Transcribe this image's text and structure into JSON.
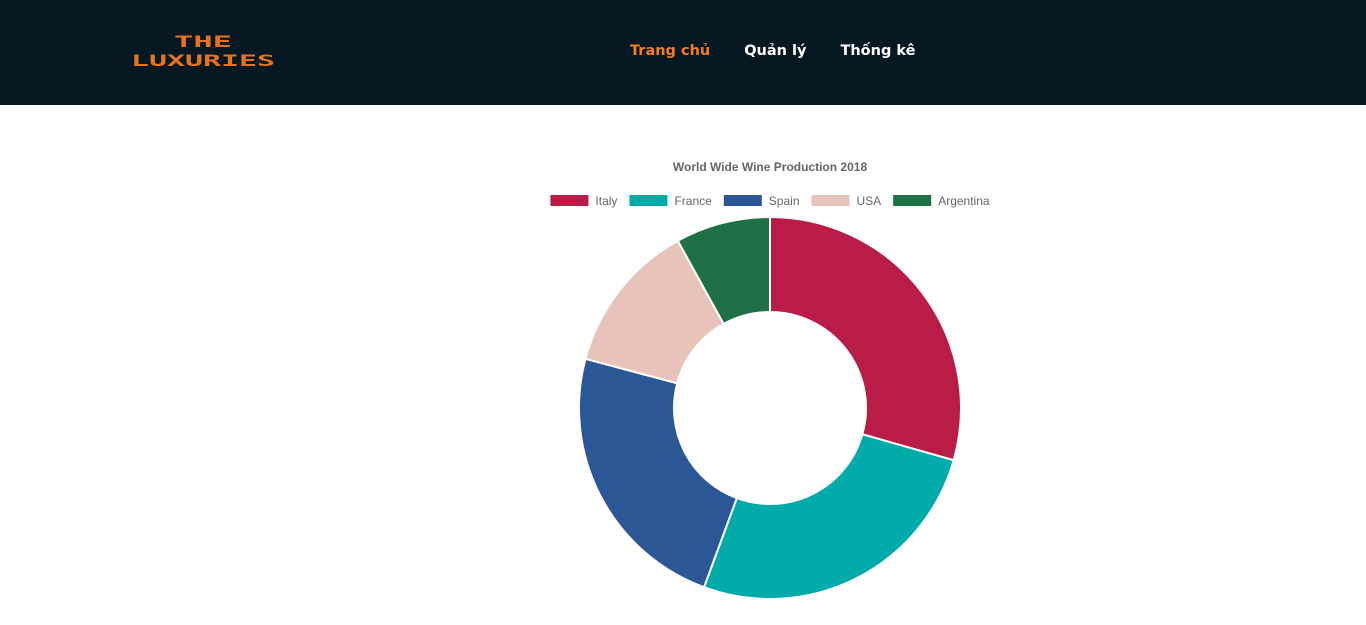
{
  "brand": {
    "line1": "THE",
    "line2": "LUXURIES",
    "color": "#e8731c"
  },
  "nav": {
    "items": [
      {
        "label": "Trang chủ",
        "active": true
      },
      {
        "label": "Quản lý",
        "active": false
      },
      {
        "label": "Thống kê",
        "active": false
      }
    ],
    "active_color": "#f57c1f",
    "bg_color": "#061922"
  },
  "chart_data": {
    "type": "pie",
    "variant": "doughnut",
    "title": "World Wide Wine Production 2018",
    "legend_position": "top",
    "categories": [
      "Italy",
      "France",
      "Spain",
      "USA",
      "Argentina"
    ],
    "values": [
      55,
      49,
      44,
      24,
      15
    ],
    "colors": [
      "#b91d47",
      "#00aba9",
      "#2b5797",
      "#e8c3b9",
      "#1e7145"
    ]
  }
}
